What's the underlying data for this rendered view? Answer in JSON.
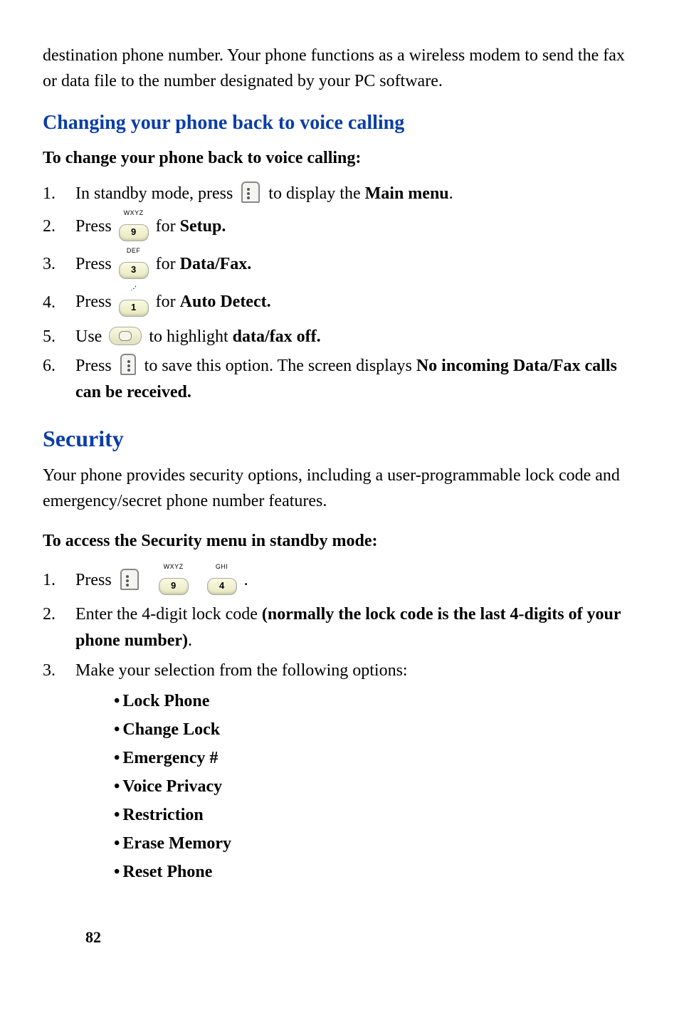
{
  "intro_para": "destination phone number. Your phone functions as a wireless modem to send the fax or data file to the number designated by your PC software.",
  "heading_changing": "Changing your phone back to voice calling",
  "subheading_tochange": "To change your phone back to voice calling:",
  "steps_change": [
    {
      "num": "1.",
      "pre": "In standby mode, press ",
      "icon": "menu",
      "post": " to display the ",
      "bold": "Main menu",
      "tail": "."
    },
    {
      "num": "2.",
      "pre": "Press  ",
      "key_sup": "WXYZ",
      "key_main": "9",
      "post": "  for ",
      "bold": "Setup."
    },
    {
      "num": "3.",
      "pre": "Press ",
      "key_sup": "DEF",
      "key_main": "3",
      "post": " for ",
      "bold": "Data/Fax."
    },
    {
      "num": "4.",
      "pre": "Press ",
      "key_sup": ".-'",
      "key_main": "1",
      "post": " for ",
      "bold": "Auto Detect."
    },
    {
      "num": "5.",
      "pre": "Use",
      "nav": true,
      "post": "to highlight ",
      "bold": "data/fax off."
    },
    {
      "num": "6.",
      "pre": "Press  ",
      "icon": "ok",
      "post": "  to save this option. The screen displays ",
      "bold": "No incoming Data/Fax calls can be received."
    }
  ],
  "heading_security": "Security",
  "security_para": "Your phone provides security options, including a user-programmable lock code and emergency/secret phone number features.",
  "subheading_access": "To access the Security menu in standby mode:",
  "steps_security": [
    {
      "num": "1.",
      "pre": "Press ",
      "seq": [
        {
          "icon": "menu"
        },
        {
          "key_sup": "WXYZ",
          "key_main": "9"
        },
        {
          "key_sup": "GHI",
          "key_main": "4"
        }
      ],
      "tail": " ."
    },
    {
      "num": "2.",
      "pre": "Enter the 4-digit lock code ",
      "bold": "(normally the lock code is the last 4-digits of your phone number)",
      "tail": "."
    },
    {
      "num": "3.",
      "pre": "Make your selection from the following options:"
    }
  ],
  "options": [
    "Lock Phone",
    "Change Lock",
    "Emergency #",
    "Voice Privacy",
    "Restriction",
    "Erase Memory",
    "Reset Phone"
  ],
  "page_number": "82"
}
